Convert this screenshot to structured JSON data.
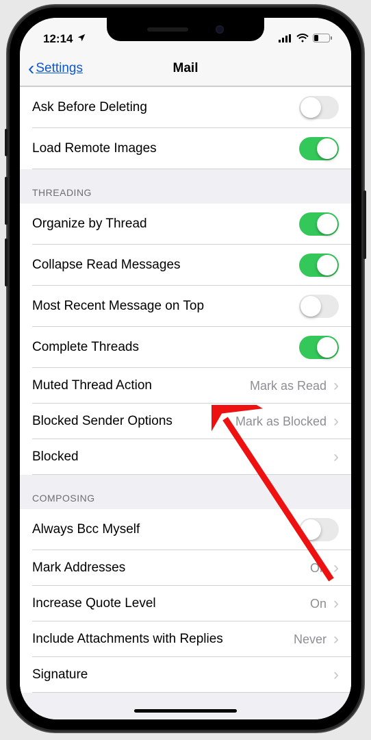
{
  "status": {
    "time": "12:14"
  },
  "nav": {
    "back": "Settings",
    "title": "Mail"
  },
  "groups": [
    {
      "header": null,
      "rows": [
        {
          "name": "ask-before-deleting",
          "label": "Ask Before Deleting",
          "type": "toggle",
          "on": false
        },
        {
          "name": "load-remote-images",
          "label": "Load Remote Images",
          "type": "toggle",
          "on": true
        }
      ]
    },
    {
      "header": "THREADING",
      "rows": [
        {
          "name": "organize-by-thread",
          "label": "Organize by Thread",
          "type": "toggle",
          "on": true
        },
        {
          "name": "collapse-read-messages",
          "label": "Collapse Read Messages",
          "type": "toggle",
          "on": true
        },
        {
          "name": "most-recent-on-top",
          "label": "Most Recent Message on Top",
          "type": "toggle",
          "on": false
        },
        {
          "name": "complete-threads",
          "label": "Complete Threads",
          "type": "toggle",
          "on": true
        },
        {
          "name": "muted-thread-action",
          "label": "Muted Thread Action",
          "type": "nav",
          "detail": "Mark as Read"
        },
        {
          "name": "blocked-sender-options",
          "label": "Blocked Sender Options",
          "type": "nav",
          "detail": "Mark as Blocked"
        },
        {
          "name": "blocked",
          "label": "Blocked",
          "type": "nav",
          "detail": ""
        }
      ]
    },
    {
      "header": "COMPOSING",
      "rows": [
        {
          "name": "always-bcc-myself",
          "label": "Always Bcc Myself",
          "type": "toggle",
          "on": false
        },
        {
          "name": "mark-addresses",
          "label": "Mark Addresses",
          "type": "nav",
          "detail": "On"
        },
        {
          "name": "increase-quote-level",
          "label": "Increase Quote Level",
          "type": "nav",
          "detail": "On"
        },
        {
          "name": "include-attachments",
          "label": "Include Attachments with Replies",
          "type": "nav",
          "detail": "Never"
        },
        {
          "name": "signature",
          "label": "Signature",
          "type": "nav",
          "detail": ""
        }
      ]
    }
  ]
}
